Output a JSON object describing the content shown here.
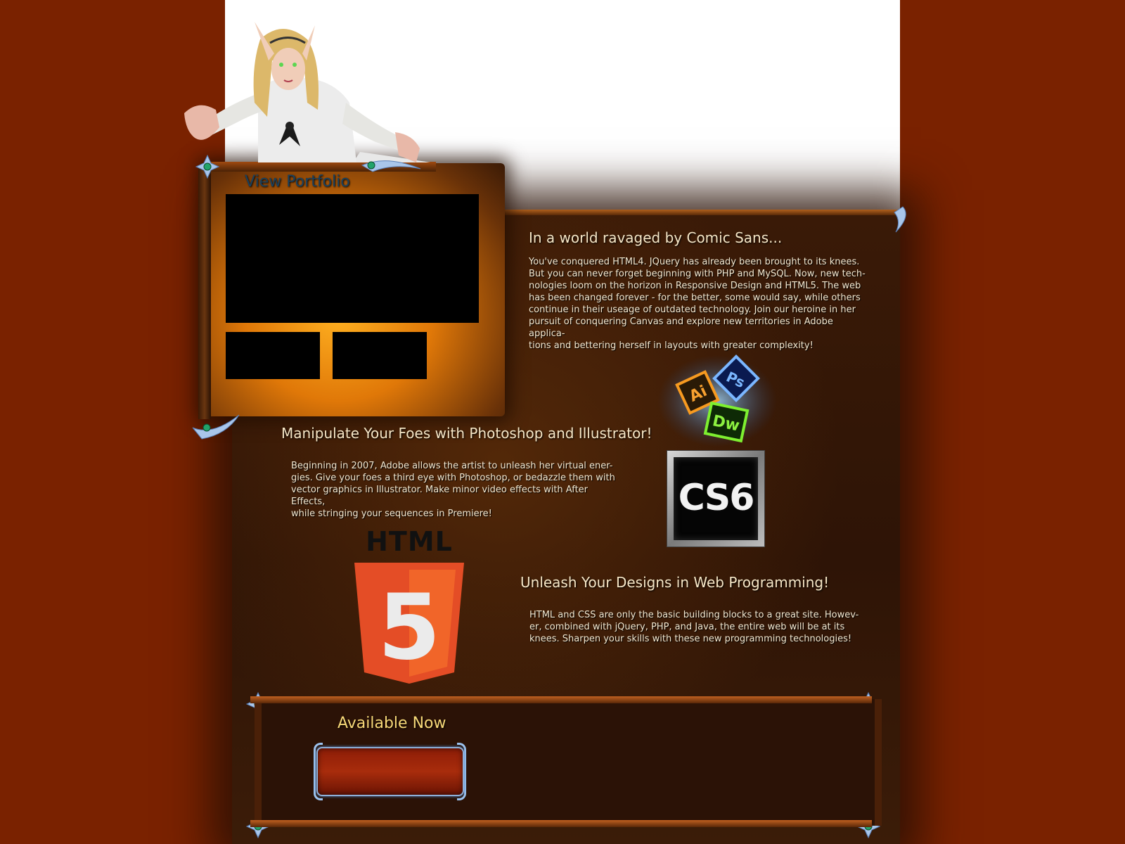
{
  "portfolio": {
    "link_label": "View Portfolio"
  },
  "section_intro": {
    "title": "In a world ravaged by Comic Sans...",
    "body_lines": [
      "You've conquered HTML4.  JQuery has already been brought to its knees.",
      "But you can never forget beginning with PHP and MySQL.  Now, new tech-",
      "nologies loom on the horizon in Responsive Design and HTML5.  The web",
      "has been changed forever - for the better, some would say, while others",
      "continue in their useage of outdated technology.  Join our heroine in her",
      "pursuit of conquering Canvas and explore new territories in Adobe applica-",
      "tions and bettering herself in layouts with greater complexity!"
    ]
  },
  "section_adobe": {
    "title": "Manipulate Your Foes with Photoshop and Illustrator!",
    "body_lines": [
      "Beginning in 2007, Adobe allows the artist to unleash her virtual ener-",
      "gies.  Give your foes a third eye with Photoshop, or bedazzle them with",
      "vector graphics in Illustrator.  Make minor video effects with After Effects,",
      "while stringing your sequences in Premiere!"
    ],
    "logo_label": "CS6",
    "app_icons": [
      "Ai",
      "Ps",
      "Dw"
    ]
  },
  "section_web": {
    "title": "Unleash Your Designs in Web Programming!",
    "body_lines": [
      "HTML and CSS are only the basic building blocks to a great site.  Howev-",
      "er, combined with jQuery, PHP, and Java, the entire web will be at its",
      "knees.  Sharpen your skills with these new programming technologies!"
    ],
    "logo_label": "HTML",
    "logo_number": "5"
  },
  "footer": {
    "title": "Available Now"
  },
  "colors": {
    "page_bg": "#7a2200",
    "panel_bg": "#2e1406",
    "accent_orange": "#e07808",
    "title_text": "#f6e6c6",
    "link_blue": "#19415f",
    "available_gold": "#f7d878",
    "html5_orange": "#e44d26"
  },
  "icons": [
    "heroine-image",
    "gem-icon",
    "adobe-app-icons",
    "cs6-logo",
    "html5-logo"
  ]
}
